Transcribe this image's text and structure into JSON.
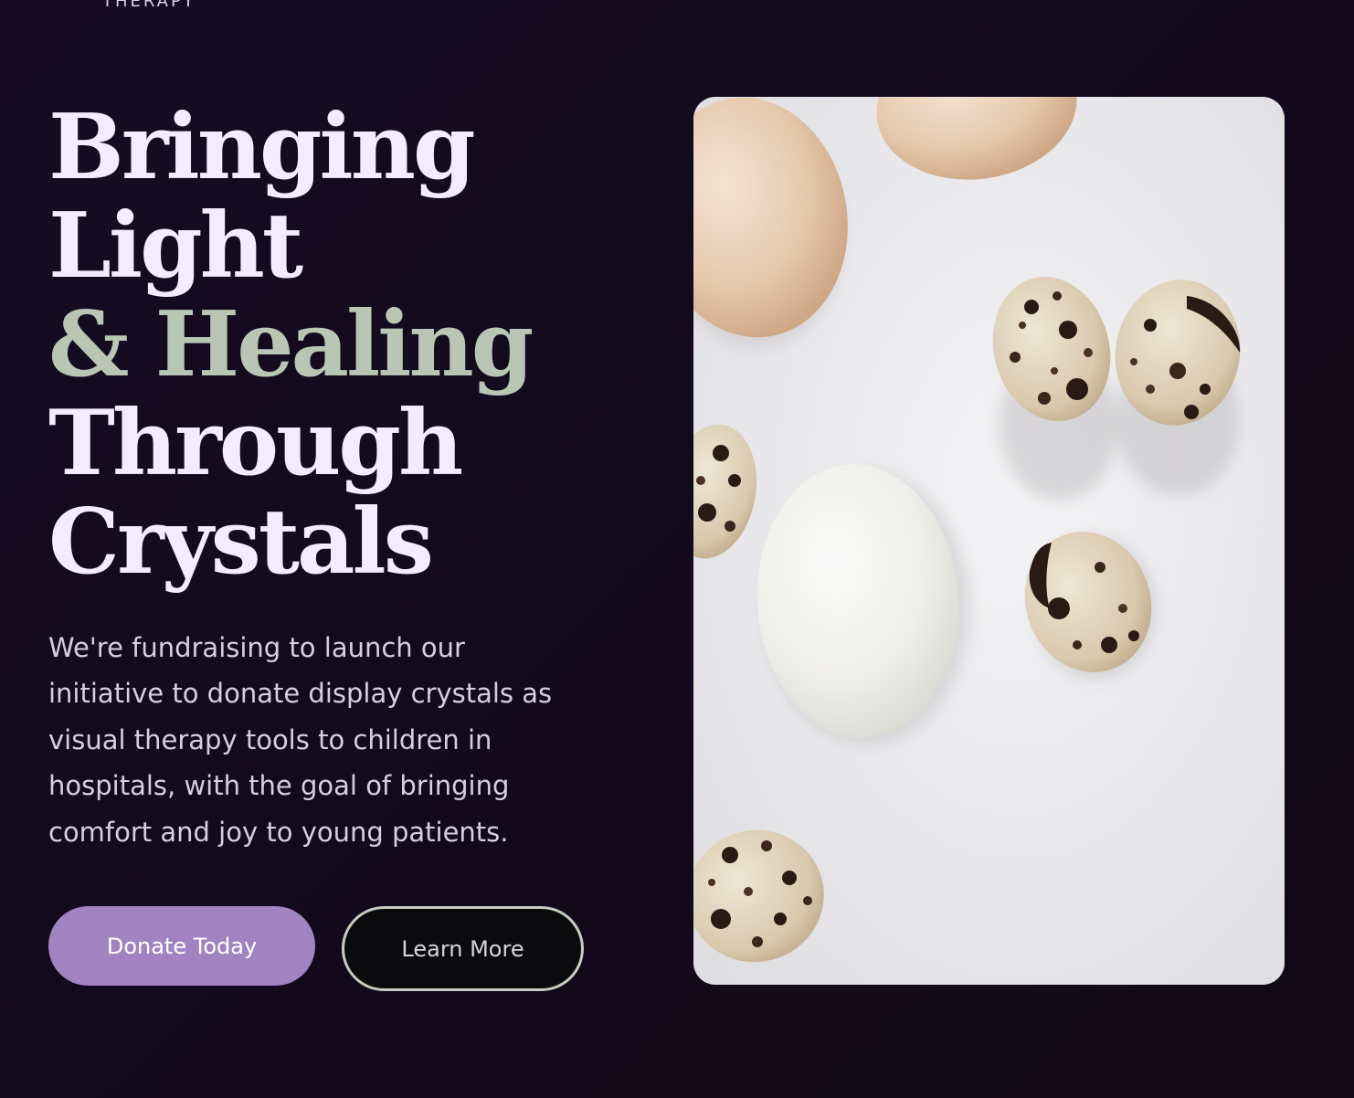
{
  "brand": {
    "fragment": "THERAPY"
  },
  "hero": {
    "headline": {
      "line1": "Bringing",
      "line2": "Light",
      "line3": "& Healing",
      "line4": "Through",
      "line5": "Crystals"
    },
    "description": "We're fundraising to launch our initiative to donate display crystals as visual therapy tools to children in hospitals, with the goal of bringing comfort and joy to young patients.",
    "buttons": {
      "donate_label": "Donate Today",
      "learn_label": "Learn More"
    },
    "image": {
      "subject": "eggs-and-quail-eggs-on-white-marble"
    }
  },
  "colors": {
    "background": "#140b1f",
    "headline": "#f3ecff",
    "accent": "#b9c6b4",
    "body_text": "#d6cfe0",
    "donate_button": "#a283c1",
    "learn_button_border": "#c6ccbf"
  }
}
